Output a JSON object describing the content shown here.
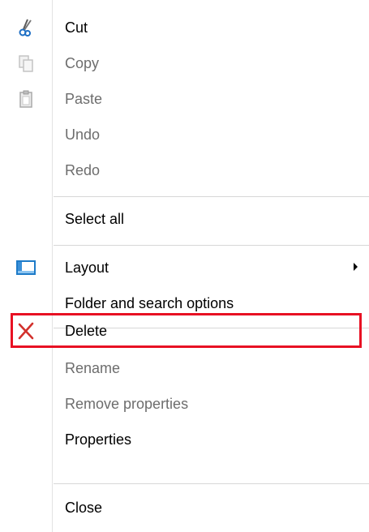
{
  "menu": {
    "items": [
      {
        "label": "Cut",
        "icon": "scissors-icon",
        "enabled": true
      },
      {
        "label": "Copy",
        "icon": "copy-icon",
        "enabled": false
      },
      {
        "label": "Paste",
        "icon": "paste-icon",
        "enabled": false
      },
      {
        "label": "Undo",
        "enabled": false
      },
      {
        "label": "Redo",
        "enabled": false
      },
      {
        "label": "Select all",
        "enabled": true
      },
      {
        "label": "Layout",
        "icon": "layout-icon",
        "enabled": true,
        "has_submenu": true
      },
      {
        "label": "Folder and search options",
        "enabled": true
      },
      {
        "label": "Delete",
        "icon": "delete-x-icon",
        "enabled": true,
        "highlighted": true
      },
      {
        "label": "Rename",
        "enabled": false
      },
      {
        "label": "Remove properties",
        "enabled": false
      },
      {
        "label": "Properties",
        "enabled": true
      },
      {
        "label": "Close",
        "enabled": true
      }
    ]
  },
  "colors": {
    "highlight_border": "#e81123",
    "disabled_text": "#6d6d6d",
    "enabled_text": "#000000",
    "delete_icon": "#d2312c",
    "layout_icon": "#1e7bc8"
  }
}
